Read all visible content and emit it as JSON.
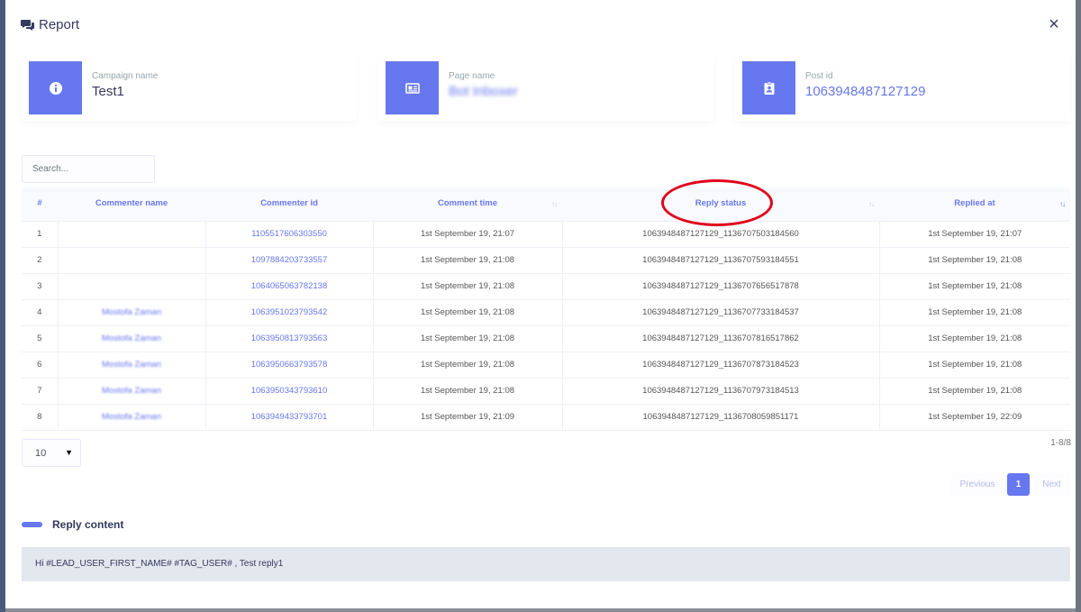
{
  "modal": {
    "title": "Report",
    "close_label": "×"
  },
  "cards": [
    {
      "label": "Campaign name",
      "value": "Test1",
      "icon": "info-circle-icon"
    },
    {
      "label": "Page name",
      "value": "Bot Inboxer",
      "icon": "newspaper-icon"
    },
    {
      "label": "Post id",
      "value": "1063948487127129",
      "icon": "id-badge-icon"
    }
  ],
  "search": {
    "placeholder": "Search..."
  },
  "table": {
    "headers": [
      "#",
      "Commenter name",
      "Commenter id",
      "Comment time",
      "Reply status",
      "Replied at"
    ],
    "rows": [
      [
        "1",
        "",
        "1105517606303550",
        "1st September 19, 21:07",
        "1063948487127129_1136707503184560",
        "1st September 19, 21:07"
      ],
      [
        "2",
        "",
        "1097884203733557",
        "1st September 19, 21:08",
        "1063948487127129_1136707593184551",
        "1st September 19, 21:08"
      ],
      [
        "3",
        "",
        "1064065063782138",
        "1st September 19, 21:08",
        "1063948487127129_1136707656517878",
        "1st September 19, 21:08"
      ],
      [
        "4",
        "Mostofa Zaman",
        "1063951023793542",
        "1st September 19, 21:08",
        "1063948487127129_1136707733184537",
        "1st September 19, 21:08"
      ],
      [
        "5",
        "Mostofa Zaman",
        "1063950813793563",
        "1st September 19, 21:08",
        "1063948487127129_1136707816517862",
        "1st September 19, 21:08"
      ],
      [
        "6",
        "Mostofa Zaman",
        "1063950663793578",
        "1st September 19, 21:08",
        "1063948487127129_1136707873184523",
        "1st September 19, 21:08"
      ],
      [
        "7",
        "Mostofa Zaman",
        "1063950343793610",
        "1st September 19, 21:08",
        "1063948487127129_1136707973184513",
        "1st September 19, 21:08"
      ],
      [
        "8",
        "Mostofa Zaman",
        "1063949433793701",
        "1st September 19, 21:09",
        "1063948487127129_1136708059851171",
        "1st September 19, 22:09"
      ]
    ]
  },
  "pagination": {
    "page_size": "10",
    "range_info": "1-8/8",
    "previous_label": "Previous",
    "current_page": "1",
    "next_label": "Next"
  },
  "reply_section": {
    "title": "Reply content",
    "content": "Hi #LEAD_USER_FIRST_NAME# #TAG_USER# , Test reply1"
  },
  "colors": {
    "accent": "#6777ef",
    "highlight": "#e0001b"
  }
}
